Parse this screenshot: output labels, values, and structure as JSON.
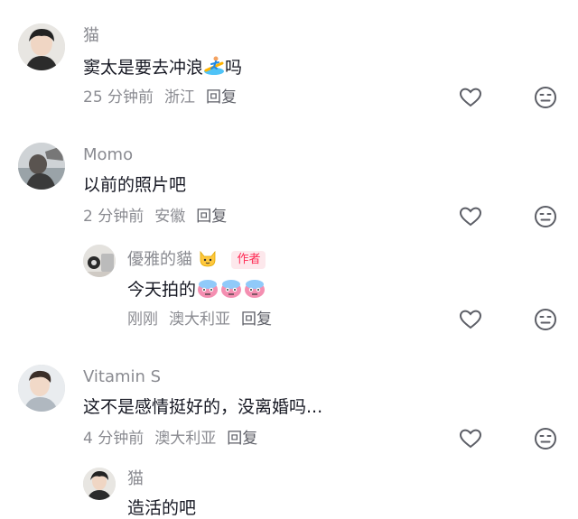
{
  "comments": [
    {
      "username": "猫",
      "text": "窦太是要去冲浪",
      "text_tail": "吗",
      "emoji": "surfer-emoji",
      "time": "25 分钟前",
      "location": "浙江",
      "reply_label": "回复",
      "like_icon": "heart-outline-icon",
      "dislike_icon": "neutral-face-icon"
    },
    {
      "username": "Momo",
      "text": "以前的照片吧",
      "time": "2 分钟前",
      "location": "安徽",
      "reply_label": "回复",
      "like_icon": "heart-outline-icon",
      "dislike_icon": "neutral-face-icon",
      "replies": [
        {
          "username": "優雅的貓",
          "name_emoji": "cat-face-emoji",
          "author_badge": "作者",
          "text": "今天拍的",
          "emojis": [
            "cold-face-emoji",
            "cold-face-emoji",
            "cold-face-emoji"
          ],
          "time": "刚刚",
          "location": "澳大利亚",
          "reply_label": "回复",
          "like_icon": "heart-outline-icon",
          "dislike_icon": "neutral-face-icon"
        }
      ]
    },
    {
      "username": "Vitamin S",
      "text": "这不是感情挺好的，没离婚吗...",
      "time": "4 分钟前",
      "location": "澳大利亚",
      "reply_label": "回复",
      "like_icon": "heart-outline-icon",
      "dislike_icon": "neutral-face-icon",
      "replies": [
        {
          "username": "猫",
          "text": "造活的吧"
        }
      ]
    }
  ],
  "colors": {
    "name": "#8a8b91",
    "text": "#161823",
    "badge_text": "#fe2c55",
    "badge_bg": "#fde8ec"
  }
}
